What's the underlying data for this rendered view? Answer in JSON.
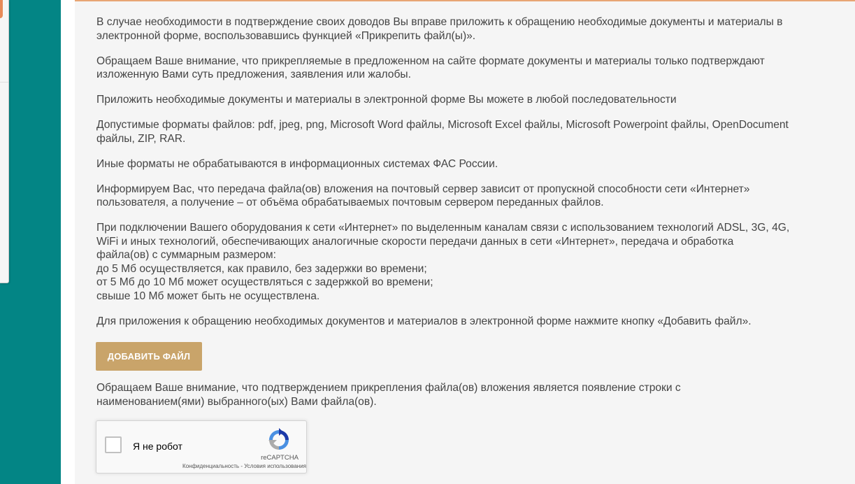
{
  "paragraphs": [
    "В случае необходимости в подтверждение своих доводов Вы вправе приложить к обращению необходимые документы и материалы в\nэлектронной форме, воспользовавшись функцией «Прикрепить файл(ы)».",
    "Обращаем Ваше внимание, что прикрепляемые в предложенном на сайте формате документы и материалы только подтверждают\nизложенную Вами суть предложения, заявления или жалобы.",
    "Приложить необходимые документы и материалы в электронной форме Вы можете в любой последовательности",
    "Допустимые форматы файлов: pdf, jpeg, png, Microsoft Word файлы, Microsoft Excel файлы, Microsoft Powerpoint файлы, OpenDocument\nфайлы, ZIP, RAR.",
    "Иные форматы не обрабатываются в информационных системах ФАС России.",
    "Информируем Вас, что передача файла(ов) вложения на  почтовый сервер зависит от пропускной способности сети «Интернет»\nпользователя, а получение – от объёма обрабатываемых почтовым сервером переданных файлов.",
    "При подключении Вашего оборудования к сети «Интернет» по выделенным каналам связи с использованием технологий ADSL, 3G, 4G,\nWiFi и иных технологий, обеспечивающих аналогичные скорости передачи данных в сети «Интернет», передача и обработка\nфайла(ов) с суммарным размером:\nдо 5 Мб осуществляется, как правило, без задержки во времени;\nот 5 Мб до 10 Мб может осуществляться с задержкой во времени;\nсвыше 10 Мб может быть не осуществлена.",
    "Для приложения к обращению необходимых документов и материалов в электронной форме нажмите кнопку «Добавить файл»."
  ],
  "add_button_label": "ДОБАВИТЬ ФАЙЛ",
  "after_note": "Обращаем Ваше внимание, что подтверждением прикрепления файла(ов) вложения является появление строки с\nнаименованием(ями) выбранного(ых) Вами файла(ов).",
  "recaptcha": {
    "label": "Я не робот",
    "brand": "reCAPTCHA",
    "privacy": "Конфиденциальность",
    "separator": " - ",
    "terms": "Условия использования",
    "logo_icon": "recaptcha-logo-icon"
  },
  "colors": {
    "sidebar": "#038585",
    "button": "#c9a46a",
    "text": "#444444",
    "accent_border": "#e8a574"
  }
}
